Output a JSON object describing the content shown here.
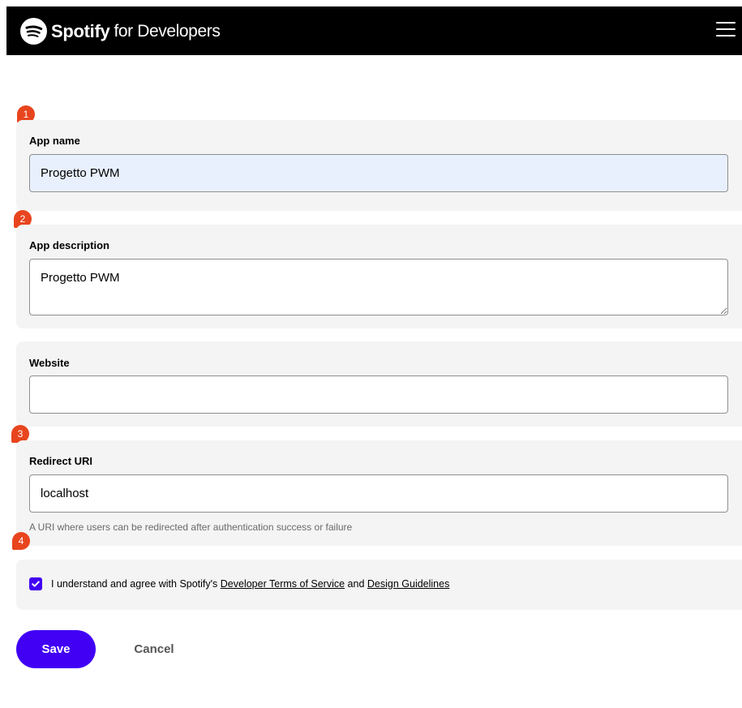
{
  "header": {
    "brand": "Spotify",
    "brand_suffix": "for Developers",
    "logo_icon": "spotify-logo-icon",
    "menu_icon": "hamburger-menu-icon"
  },
  "form": {
    "app_name": {
      "badge": "1",
      "label": "App name",
      "value": "Progetto PWM"
    },
    "app_description": {
      "badge": "2",
      "label": "App description",
      "value": "Progetto PWM"
    },
    "website": {
      "label": "Website",
      "value": ""
    },
    "redirect_uri": {
      "badge": "3",
      "label": "Redirect URI",
      "value": "localhost",
      "help": "A URI where users can be redirected after authentication success or failure"
    },
    "terms": {
      "badge": "4",
      "checked": true,
      "text_before": "I understand and agree with Spotify's ",
      "link_terms": "Developer Terms of Service",
      "text_middle": " and ",
      "link_guidelines": "Design Guidelines"
    }
  },
  "actions": {
    "save_label": "Save",
    "cancel_label": "Cancel"
  },
  "colors": {
    "header_bg": "#000000",
    "accent": "#4100f4",
    "badge": "#e8451e",
    "section_bg": "#f4f4f4",
    "autofill_bg": "#e8f0fe"
  }
}
